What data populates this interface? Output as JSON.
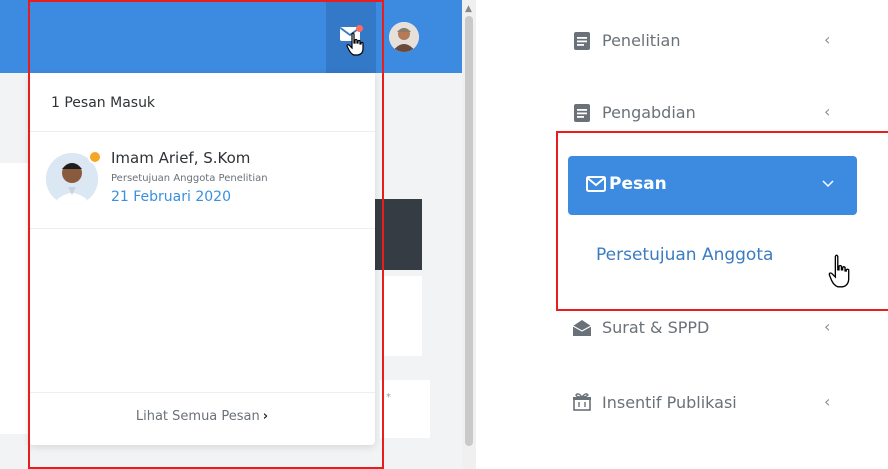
{
  "colors": {
    "topbar": "#3d8be0",
    "accent": "#3d8be0",
    "link_date": "#3a8fe0",
    "highlight_box": "#e81d1d",
    "badge_dot": "#ff6b5e",
    "status_dot": "#f5a623"
  },
  "notifications": {
    "header": "1 Pesan Masuk",
    "messages": [
      {
        "sender": "Imam Arief, S.Kom",
        "subject": "Persetujuan Anggota Penelitian",
        "date": "21 Februari 2020"
      }
    ],
    "see_all_label": "Lihat Semua Pesan",
    "see_all_chevron": "›"
  },
  "sidebar": {
    "items": [
      {
        "label": "Penelitian",
        "icon": "document-icon",
        "chevron": "‹"
      },
      {
        "label": "Pengabdian",
        "icon": "document-icon",
        "chevron": "‹"
      },
      {
        "label": "Pesan",
        "icon": "envelope-icon",
        "chevron": "⌄",
        "active": true
      },
      {
        "label": "Surat & SPPD",
        "icon": "open-envelope-icon",
        "chevron": "‹"
      },
      {
        "label": "Insentif Publikasi",
        "icon": "gift-box-icon",
        "chevron": "‹"
      }
    ],
    "pesan_submenu": [
      {
        "label": "Persetujuan Anggota"
      }
    ]
  }
}
